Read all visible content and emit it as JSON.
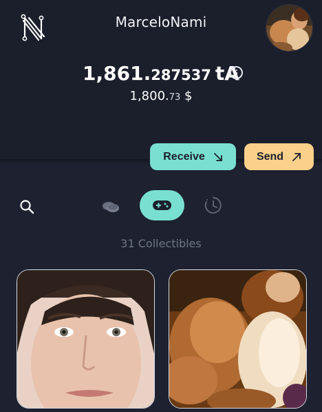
{
  "header": {
    "logo_icon": "n-network-logo",
    "username": "MarceloNami",
    "avatar_icon": "profile-avatar"
  },
  "balance": {
    "integer_part": "1,861.",
    "decimal_part": "287537",
    "unit": "tA",
    "info_icon": "info-circle-icon",
    "usd_integer": "1,800.",
    "usd_decimal": "73",
    "usd_unit": " $"
  },
  "actions": {
    "receive_label": "Receive",
    "receive_icon": "arrow-down-right-icon",
    "send_label": "Send",
    "send_icon": "arrow-up-right-icon"
  },
  "tabs": {
    "search_icon": "search-icon",
    "assets_icon": "coins-icon",
    "collectibles_icon": "gamepad-icon",
    "history_icon": "history-clock-icon",
    "active": "collectibles"
  },
  "collectibles": {
    "count_label": "31 Collectibles",
    "items": [
      {
        "icon": "portrait-face-image"
      },
      {
        "icon": "classical-painting-image"
      }
    ]
  },
  "colors": {
    "background": "#1d2130",
    "accent_teal": "#79e0d1",
    "accent_orange": "#fad08a",
    "muted_text": "#6f7584"
  }
}
